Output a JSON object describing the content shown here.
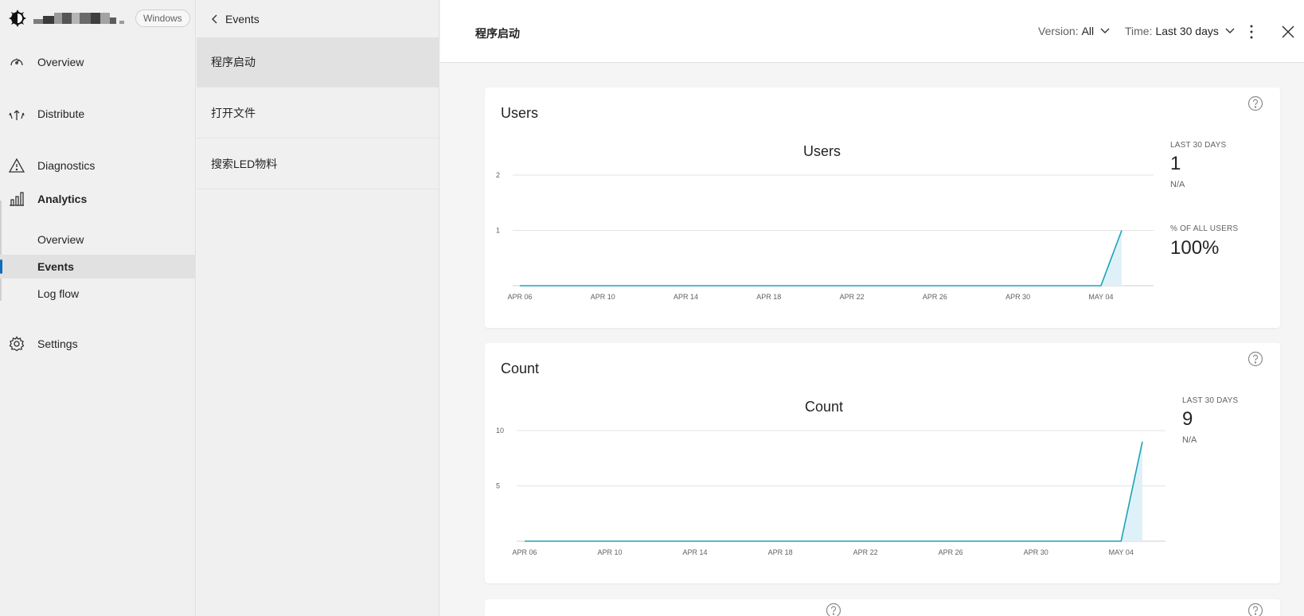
{
  "app": {
    "os_badge": "Windows"
  },
  "nav": {
    "overview": "Overview",
    "distribute": "Distribute",
    "diagnostics": "Diagnostics",
    "analytics": "Analytics",
    "analytics_sub": [
      "Overview",
      "Events",
      "Log flow"
    ],
    "settings": "Settings"
  },
  "events_panel": {
    "back_label": "Events",
    "items": [
      "程序启动",
      "打开文件",
      "搜索LED物料"
    ]
  },
  "main": {
    "title": "程序启动",
    "version_label": "Version:",
    "version_value": "All",
    "time_label": "Time:",
    "time_value": "Last 30 days"
  },
  "cards": {
    "users": {
      "title": "Users",
      "chart_title": "Users",
      "stat1_label": "LAST 30 DAYS",
      "stat1_value": "1",
      "stat1_sub": "N/A",
      "stat2_label": "% OF ALL USERS",
      "stat2_value": "100%"
    },
    "count": {
      "title": "Count",
      "chart_title": "Count",
      "stat1_label": "LAST 30 DAYS",
      "stat1_value": "9",
      "stat1_sub": "N/A"
    }
  },
  "colors": {
    "accent": "#0f6cbd",
    "line": "#1aa3b8",
    "fill": "#dff1f8"
  },
  "chart_data": [
    {
      "type": "area",
      "title": "Users",
      "x_tick_labels": [
        "APR 06",
        "APR 10",
        "APR 14",
        "APR 18",
        "APR 22",
        "APR 26",
        "APR 30",
        "MAY 04"
      ],
      "y_ticks": [
        1,
        2
      ],
      "ylim": [
        0,
        2
      ],
      "series": [
        {
          "values": [
            0,
            0,
            0,
            0,
            0,
            0,
            0,
            0,
            0,
            0,
            0,
            0,
            0,
            0,
            0,
            0,
            0,
            0,
            0,
            0,
            0,
            0,
            0,
            0,
            0,
            0,
            0,
            0,
            0,
            1
          ]
        }
      ]
    },
    {
      "type": "area",
      "title": "Count",
      "x_tick_labels": [
        "APR 06",
        "APR 10",
        "APR 14",
        "APR 18",
        "APR 22",
        "APR 26",
        "APR 30",
        "MAY 04"
      ],
      "y_ticks": [
        5,
        10
      ],
      "ylim": [
        0,
        10
      ],
      "series": [
        {
          "values": [
            0,
            0,
            0,
            0,
            0,
            0,
            0,
            0,
            0,
            0,
            0,
            0,
            0,
            0,
            0,
            0,
            0,
            0,
            0,
            0,
            0,
            0,
            0,
            0,
            0,
            0,
            0,
            0,
            0,
            9
          ]
        }
      ]
    }
  ]
}
